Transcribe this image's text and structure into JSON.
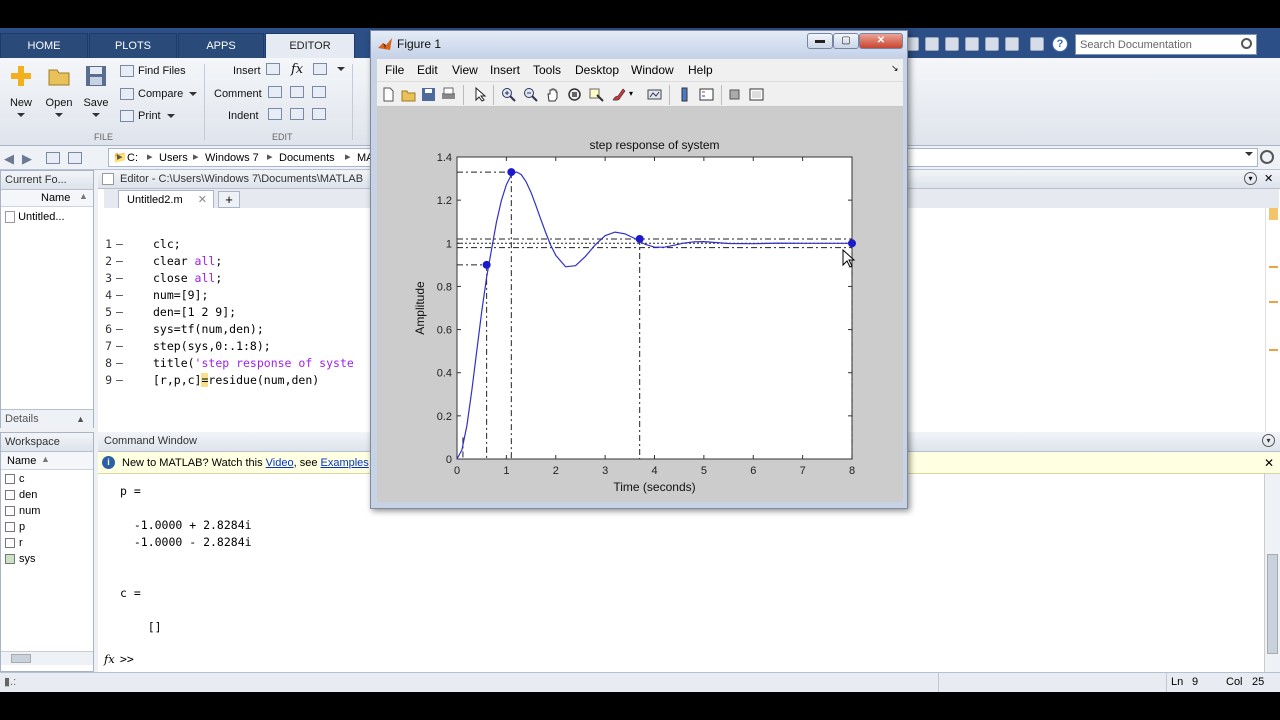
{
  "tabs": [
    "HOME",
    "PLOTS",
    "APPS",
    "EDITOR"
  ],
  "active_tab": "EDITOR",
  "search_placeholder": "Search Documentation",
  "ribbon": {
    "new_label": "New",
    "open_label": "Open",
    "save_label": "Save",
    "find_files": "Find Files",
    "compare": "Compare",
    "print": "Print",
    "insert": "Insert",
    "comment": "Comment",
    "indent": "Indent",
    "fx": "fx",
    "section_file": "FILE",
    "section_edit": "EDIT"
  },
  "address": {
    "crumbs": [
      "C:",
      "Users",
      "Windows 7",
      "Documents",
      "MA"
    ]
  },
  "current_folder": {
    "title": "Current Fo...",
    "column": "Name",
    "item": "Untitled...",
    "details": "Details"
  },
  "editor": {
    "title": "Editor - C:\\Users\\Windows 7\\Documents\\MATLAB",
    "tab": "Untitled2.m",
    "add_tab": "+",
    "lines": [
      {
        "n": "1",
        "dash": "–",
        "parts": [
          {
            "t": "clc;",
            "c": "plain"
          }
        ]
      },
      {
        "n": "2",
        "dash": "–",
        "parts": [
          {
            "t": "clear ",
            "c": "plain"
          },
          {
            "t": "all",
            "c": "kw"
          },
          {
            "t": ";",
            "c": "plain"
          }
        ]
      },
      {
        "n": "3",
        "dash": "–",
        "parts": [
          {
            "t": "close ",
            "c": "plain"
          },
          {
            "t": "all",
            "c": "kw"
          },
          {
            "t": ";",
            "c": "plain"
          }
        ]
      },
      {
        "n": "4",
        "dash": "–",
        "parts": [
          {
            "t": "num=[9];",
            "c": "plain"
          }
        ]
      },
      {
        "n": "5",
        "dash": "–",
        "parts": [
          {
            "t": "den=[1 2 9];",
            "c": "plain"
          }
        ]
      },
      {
        "n": "6",
        "dash": "–",
        "parts": [
          {
            "t": "sys=tf(num,den);",
            "c": "plain"
          }
        ]
      },
      {
        "n": "7",
        "dash": "–",
        "parts": [
          {
            "t": "step(sys,0:.1:8);",
            "c": "plain"
          }
        ]
      },
      {
        "n": "8",
        "dash": "–",
        "parts": [
          {
            "t": "title(",
            "c": "plain"
          },
          {
            "t": "'step response of syste",
            "c": "str"
          }
        ]
      },
      {
        "n": "9",
        "dash": "–",
        "parts": [
          {
            "t": "[r,p,c]",
            "c": "plain"
          },
          {
            "t": "=",
            "c": "hl"
          },
          {
            "t": "residue(num,den)",
            "c": "plain"
          }
        ]
      }
    ]
  },
  "workspace": {
    "title": "Workspace",
    "column": "Name",
    "vars": [
      "c",
      "den",
      "num",
      "p",
      "r",
      "sys"
    ]
  },
  "command": {
    "title": "Command Window",
    "info_prefix": "New to MATLAB? Watch this ",
    "info_video": "Video",
    "info_mid": ", see ",
    "info_examples": "Examples",
    "out_p": "p =",
    "out_p1": "  -1.0000 + 2.8284i",
    "out_p2": "  -1.0000 - 2.8284i",
    "out_c": "c =",
    "out_c1": "    []",
    "prompt": ">>",
    "fx": "fx"
  },
  "status": {
    "ln_label": "Ln",
    "ln": "9",
    "col_label": "Col",
    "col": "25"
  },
  "figure": {
    "title": "Figure 1",
    "menu": [
      "File",
      "Edit",
      "View",
      "Insert",
      "Tools",
      "Desktop",
      "Window",
      "Help"
    ]
  },
  "chart_data": {
    "type": "line",
    "title": "step response of system",
    "xlabel": "Time (seconds)",
    "ylabel": "Amplitude",
    "xlim": [
      0,
      8
    ],
    "ylim": [
      0,
      1.4
    ],
    "xticks": [
      "0",
      "1",
      "2",
      "3",
      "4",
      "5",
      "6",
      "7",
      "8"
    ],
    "yticks": [
      "0",
      "0.2",
      "0.4",
      "0.6",
      "0.8",
      "1",
      "1.2",
      "1.4"
    ],
    "series": [
      {
        "color": "#3030c8",
        "x": [
          0,
          0.1,
          0.2,
          0.3,
          0.4,
          0.5,
          0.6,
          0.7,
          0.8,
          0.9,
          1.0,
          1.1,
          1.2,
          1.3,
          1.4,
          1.5,
          1.6,
          1.7,
          1.8,
          1.9,
          2.0,
          2.2,
          2.4,
          2.6,
          2.8,
          3.0,
          3.2,
          3.4,
          3.6,
          3.8,
          4.0,
          4.2,
          4.4,
          4.6,
          4.8,
          5.0,
          5.5,
          6.0,
          6.5,
          7.0,
          7.5,
          8.0
        ],
        "y": [
          0,
          0.042,
          0.155,
          0.317,
          0.502,
          0.683,
          0.842,
          0.973,
          1.099,
          1.199,
          1.272,
          1.316,
          1.331,
          1.319,
          1.285,
          1.235,
          1.174,
          1.11,
          1.047,
          0.99,
          0.944,
          0.891,
          0.896,
          0.939,
          0.993,
          1.035,
          1.052,
          1.044,
          1.022,
          0.996,
          0.982,
          0.982,
          0.991,
          1.001,
          1.007,
          1.008,
          0.999,
          0.998,
          1.001,
          1.0,
          1.0,
          1.0
        ]
      }
    ],
    "markers": [
      {
        "label": "rise",
        "x": 0.6,
        "y": 0.9
      },
      {
        "label": "peak",
        "x": 1.1,
        "y": 1.33
      },
      {
        "label": "settling",
        "x": 3.7,
        "y": 1.02
      },
      {
        "label": "steady-state",
        "x": 8.0,
        "y": 1.0
      }
    ],
    "settling_band": [
      0.98,
      1.02
    ],
    "grid": false
  }
}
